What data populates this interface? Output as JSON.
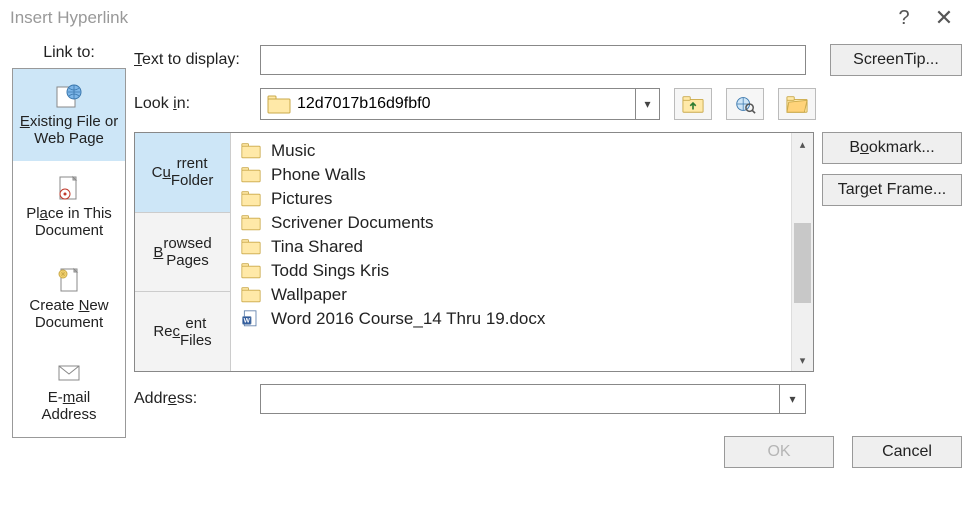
{
  "window": {
    "title": "Insert Hyperlink"
  },
  "left": {
    "header": "Link to:",
    "items": [
      {
        "label": "Existing File or Web Page",
        "selected": true
      },
      {
        "label": "Place in This Document",
        "selected": false
      },
      {
        "label": "Create New Document",
        "selected": false
      },
      {
        "label": "E-mail Address",
        "selected": false
      }
    ]
  },
  "fields": {
    "text_to_display_label": "Text to display:",
    "text_to_display_value": "",
    "look_in_label": "Look in:",
    "look_in_value": "12d7017b16d9fbf0",
    "address_label": "Address:",
    "address_value": ""
  },
  "tabs": {
    "current": "Current Folder",
    "browsed": "Browsed Pages",
    "recent": "Recent Files"
  },
  "files": [
    {
      "name": "Music",
      "type": "folder"
    },
    {
      "name": "Phone Walls",
      "type": "folder"
    },
    {
      "name": "Pictures",
      "type": "folder"
    },
    {
      "name": "Scrivener Documents",
      "type": "folder"
    },
    {
      "name": "Tina Shared",
      "type": "folder"
    },
    {
      "name": "Todd Sings Kris",
      "type": "folder"
    },
    {
      "name": "Wallpaper",
      "type": "folder"
    },
    {
      "name": "Word 2016 Course_14 Thru 19.docx",
      "type": "doc"
    }
  ],
  "buttons": {
    "screentip": "ScreenTip...",
    "bookmark": "Bookmark...",
    "target_frame": "Target Frame...",
    "ok": "OK",
    "cancel": "Cancel"
  }
}
